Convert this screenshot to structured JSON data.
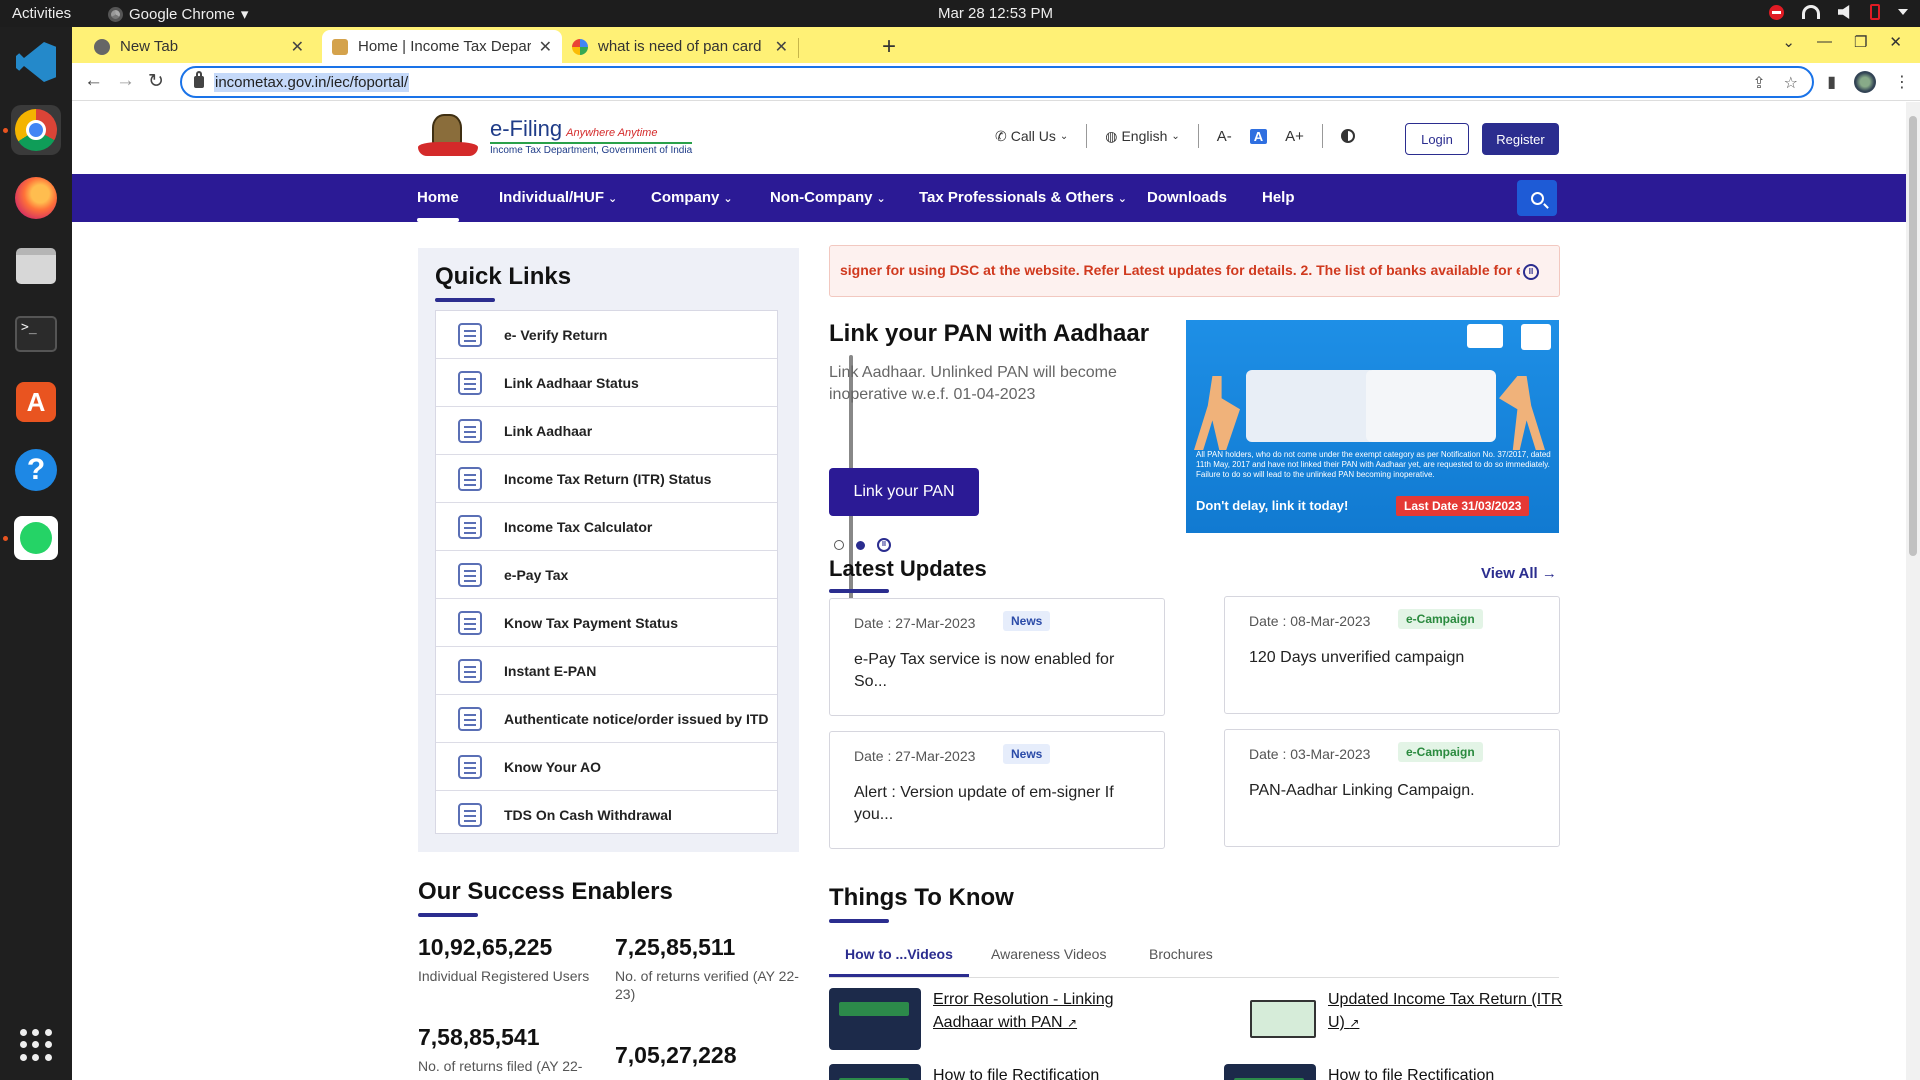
{
  "os": {
    "activities": "Activities",
    "app_name": "Google Chrome",
    "clock": "Mar 28  12:53 PM"
  },
  "browser": {
    "tabs": [
      {
        "title": "New Tab"
      },
      {
        "title": "Home | Income Tax Department"
      },
      {
        "title": "what is need of pan card"
      }
    ],
    "url": "incometax.gov.in/iec/foportal/"
  },
  "site": {
    "logo": {
      "name": "e-Filing",
      "tagline": "Anywhere Anytime",
      "subtitle": "Income Tax Department, Government of India"
    },
    "header": {
      "call_us": "Call Us",
      "language": "English",
      "font_decrease": "A-",
      "font_default": "A",
      "font_increase": "A+",
      "login": "Login",
      "register": "Register"
    },
    "nav": [
      "Home",
      "Individual/HUF",
      "Company",
      "Non-Company",
      "Tax Professionals & Others",
      "Downloads",
      "Help"
    ],
    "quick_links": {
      "title": "Quick Links",
      "items": [
        "e- Verify Return",
        "Link Aadhaar Status",
        "Link Aadhaar",
        "Income Tax Return (ITR) Status",
        "Income Tax Calculator",
        "e-Pay Tax",
        "Know Tax Payment Status",
        "Instant E-PAN",
        "Authenticate notice/order issued by ITD",
        "Know Your AO",
        "TDS On Cash Withdrawal"
      ]
    },
    "marquee": "signer for using DSC at the website. Refer Latest updates for details. 2. The list of banks available for e-",
    "hero": {
      "title": "Link your PAN with Aadhaar",
      "description": "Link Aadhaar. Unlinked PAN will become inoperative w.e.f. 01-04-2023",
      "button": "Link your PAN",
      "banner_text": "All PAN holders, who do not come under the exempt category as per Notification No. 37/2017, dated 11th May, 2017 and have not linked their PAN with Aadhaar yet, are requested to do so immediately. Failure to do so will lead to the unlinked PAN becoming inoperative.",
      "banner_cta": "Don't delay, link it today!",
      "banner_deadline": "Last Date 31/03/2023"
    },
    "latest_updates": {
      "title": "Latest Updates",
      "view_all": "View All",
      "items": [
        {
          "date": "Date : 27-Mar-2023",
          "badge": "News",
          "headline": "e-Pay Tax service is now enabled for So..."
        },
        {
          "date": "Date : 08-Mar-2023",
          "badge": "e-Campaign",
          "headline": "120 Days unverified campaign"
        },
        {
          "date": "Date : 27-Mar-2023",
          "badge": "News",
          "headline": "Alert : Version update of em-signer    If you..."
        },
        {
          "date": "Date : 03-Mar-2023",
          "badge": "e-Campaign",
          "headline": "PAN-Aadhar Linking Campaign."
        }
      ]
    },
    "success_enablers": {
      "title": "Our Success Enablers",
      "stats": [
        {
          "value": "10,92,65,225",
          "label": "Individual Registered Users"
        },
        {
          "value": "7,25,85,511",
          "label": "No. of returns verified (AY 22-23)"
        },
        {
          "value": "7,58,85,541",
          "label": "No. of returns filed (AY 22-"
        },
        {
          "value": "7,05,27,228",
          "label": ""
        }
      ]
    },
    "things_to_know": {
      "title": "Things To Know",
      "tabs": [
        "How to ...Videos",
        "Awareness Videos",
        "Brochures"
      ],
      "videos": [
        "Error Resolution - Linking Aadhaar with PAN",
        "Updated Income Tax Return (ITR U)",
        "How to file Rectification",
        "How to file Rectification"
      ]
    }
  }
}
